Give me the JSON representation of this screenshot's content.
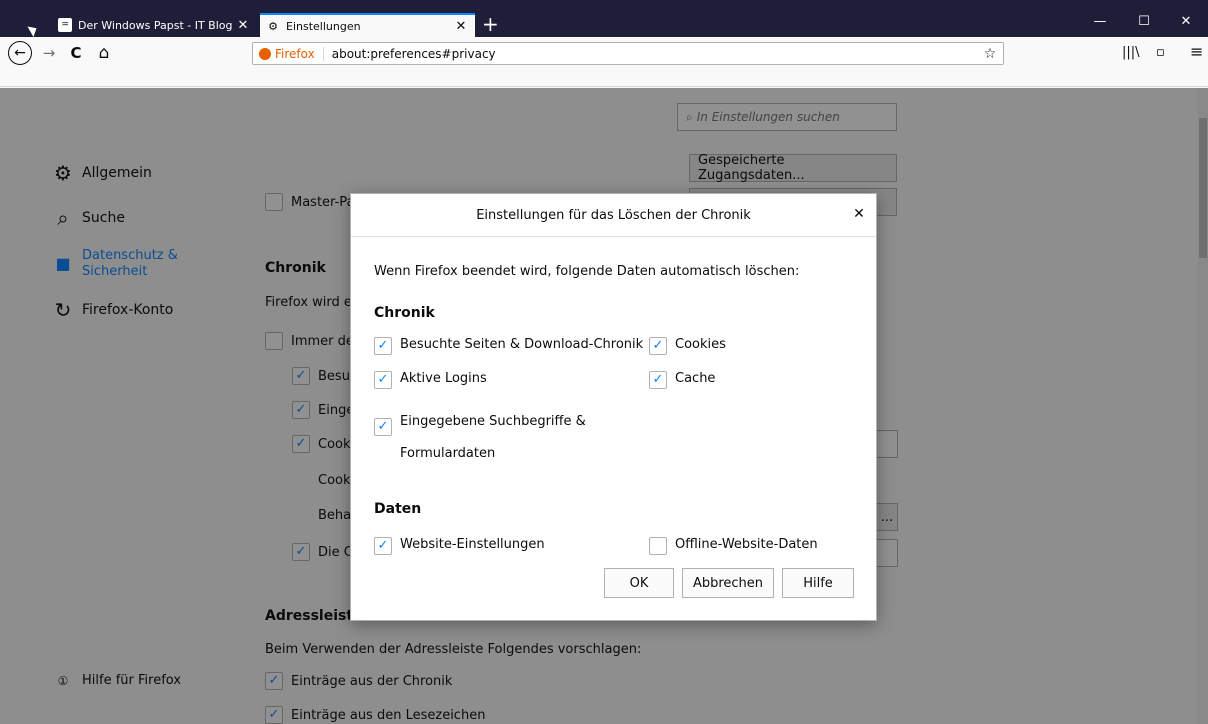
{
  "tabs": [
    {
      "title": "Der Windows Papst - IT Blog Es",
      "favicon": "♒",
      "close": "✕"
    },
    {
      "title": "Einstellungen",
      "favicon": "⚙",
      "close": "✕"
    }
  ],
  "new_tab": "+",
  "window_controls": {
    "minimize": "—",
    "maximize": "☐",
    "close": "✕"
  },
  "nav": {
    "back": "←",
    "forward": "→",
    "reload": "C",
    "home": "⌂",
    "identity_label": "Firefox",
    "url": "about:preferences#privacy",
    "star": "☆",
    "library": "|||\\",
    "sidebar": "▫",
    "menu": "≡"
  },
  "search": {
    "placeholder": "In Einstellungen suchen",
    "icon": "⌕"
  },
  "sidebar": {
    "items": [
      {
        "label": "Allgemein",
        "icon": "⚙"
      },
      {
        "label": "Suche",
        "icon": "⌕"
      },
      {
        "label": "Datenschutz & Sicherheit",
        "icon": "■"
      },
      {
        "label": "Firefox-Konto",
        "icon": "↻"
      }
    ],
    "help": {
      "label": "Hilfe für Firefox",
      "icon": "①"
    }
  },
  "background": {
    "saved_logins_btn": "Gespeicherte Zugangsdaten...",
    "master_pw": "Master-Pa",
    "chronik_heading": "Chronik",
    "firefox_wird": "Firefox wird e",
    "immer": "Immer de",
    "besuc": "Besuc",
    "einge": "Einge",
    "cook": "Cook",
    "cookies_plain": "Cookies",
    "behal": "Behal",
    "die_c": "Die C",
    "adress_heading": "Adressleiste",
    "adress_desc": "Beim Verwenden der Adressleiste Folgendes vorschlagen:",
    "eintraege_chronik": "Einträge aus der Chronik",
    "eintraege_lesezeichen": "Einträge aus den Lesezeichen",
    "ellipsis": "..."
  },
  "dialog": {
    "title": "Einstellungen für das Löschen der Chronik",
    "close": "✕",
    "intro": "Wenn Firefox beendet wird, folgende Daten automatisch löschen:",
    "chronik_heading": "Chronik",
    "chronik_items": [
      {
        "label": "Besuchte Seiten & Download-Chronik",
        "checked": true
      },
      {
        "label": "Cookies",
        "checked": true
      },
      {
        "label": "Aktive Logins",
        "checked": true
      },
      {
        "label": "Cache",
        "checked": true
      },
      {
        "label": "Eingegebene Suchbegriffe &",
        "label2": "Formulardaten",
        "checked": true
      }
    ],
    "daten_heading": "Daten",
    "daten_items": [
      {
        "label": "Website-Einstellungen",
        "checked": true
      },
      {
        "label": "Offline-Website-Daten",
        "checked": false
      }
    ],
    "buttons": {
      "ok": "OK",
      "cancel": "Abbrechen",
      "help": "Hilfe"
    },
    "checkmark": "✓"
  },
  "colors": {
    "accent": "#0a84ff",
    "titlebar": "#1e1e38",
    "firefox_orange": "#e66000"
  }
}
